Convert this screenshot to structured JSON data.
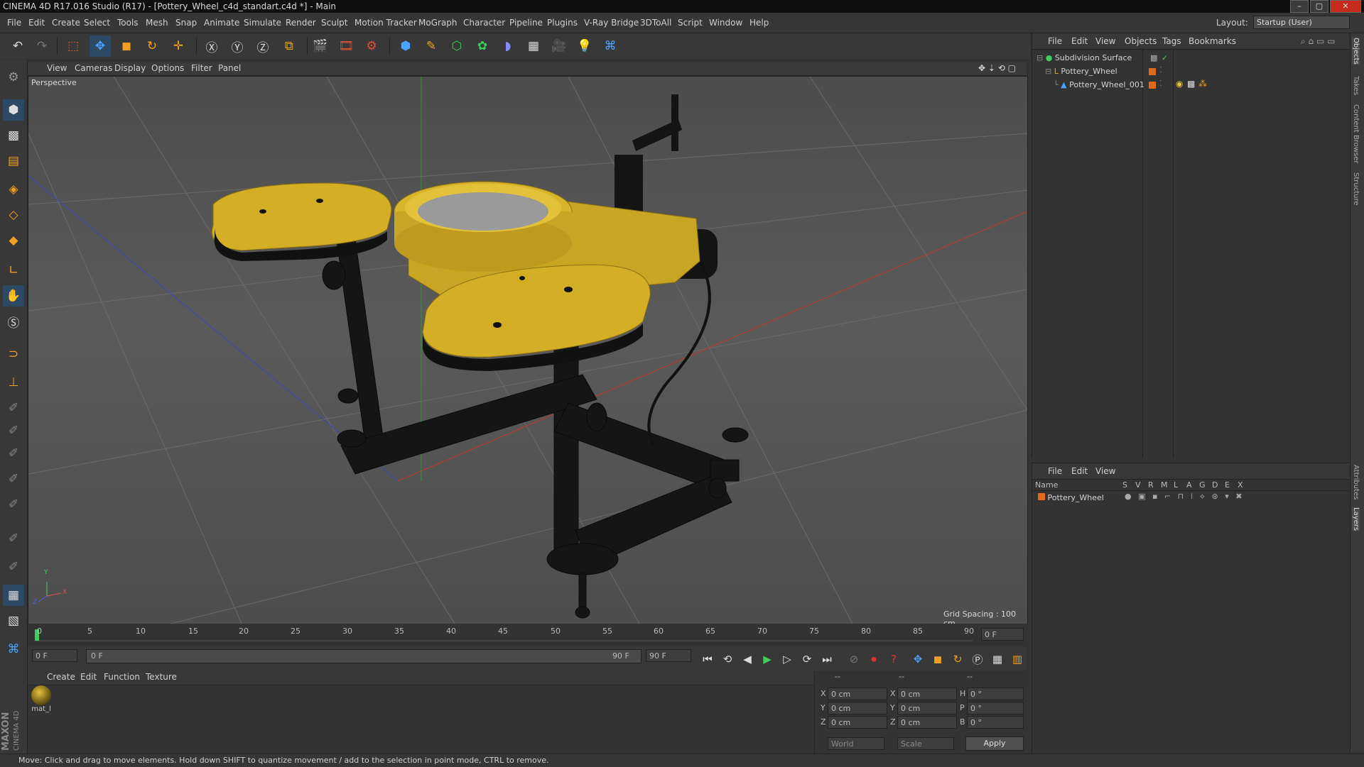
{
  "window": {
    "title": "CINEMA 4D R17.016 Studio (R17) - [Pottery_Wheel_c4d_standart.c4d *] - Main",
    "buttons": [
      "–",
      "▢",
      "✕"
    ]
  },
  "menubar": {
    "items": [
      "File",
      "Edit",
      "Create",
      "Select",
      "Tools",
      "Mesh",
      "Snap",
      "Animate",
      "Simulate",
      "Render",
      "Sculpt",
      "Motion Tracker",
      "MoGraph",
      "Character",
      "Pipeline",
      "Plugins",
      "V-Ray Bridge",
      "3DToAll",
      "Script",
      "Window",
      "Help"
    ],
    "layout_label": "Layout:",
    "layout_value": "Startup (User)"
  },
  "viewport": {
    "menu": [
      "View",
      "Cameras",
      "Display",
      "Options",
      "Filter",
      "Panel"
    ],
    "camera_label": "Perspective",
    "grid_spacing": "Grid Spacing : 100 cm",
    "axis_y": "Y",
    "axis_x": "X",
    "axis_z": "Z"
  },
  "timeline": {
    "ticks": [
      "0",
      "5",
      "10",
      "15",
      "20",
      "25",
      "30",
      "35",
      "40",
      "45",
      "50",
      "55",
      "60",
      "65",
      "70",
      "75",
      "80",
      "85",
      "90"
    ],
    "current_frame": "0 F",
    "start_field": "0 F",
    "range_start": "0 F",
    "range_end": "90 F",
    "end_field": "90 F"
  },
  "material_panel": {
    "menu": [
      "Create",
      "Edit",
      "Function",
      "Texture"
    ],
    "materials": [
      {
        "name": "mat_l"
      }
    ]
  },
  "coordinates": {
    "headers": [
      "--",
      "--",
      "--"
    ],
    "rows": [
      {
        "axis": "X",
        "pos": "0 cm",
        "axis2": "X",
        "size": "0 cm",
        "rot_axis": "H",
        "rot": "0 °"
      },
      {
        "axis": "Y",
        "pos": "0 cm",
        "axis2": "Y",
        "size": "0 cm",
        "rot_axis": "P",
        "rot": "0 °"
      },
      {
        "axis": "Z",
        "pos": "0 cm",
        "axis2": "Z",
        "size": "0 cm",
        "rot_axis": "B",
        "rot": "0 °"
      }
    ],
    "mode_world": "World",
    "mode_scale": "Scale",
    "apply": "Apply"
  },
  "object_manager": {
    "menu": [
      "File",
      "Edit",
      "View",
      "Objects",
      "Tags",
      "Bookmarks"
    ],
    "objects": [
      {
        "name": "Subdivision Surface"
      },
      {
        "name": "Pottery_Wheel"
      },
      {
        "name": "Pottery_Wheel_001"
      }
    ]
  },
  "layer_manager": {
    "menu": [
      "File",
      "Edit",
      "View"
    ],
    "columns": [
      "Name",
      "S",
      "V",
      "R",
      "M",
      "L",
      "A",
      "G",
      "D",
      "E",
      "X"
    ],
    "layers": [
      {
        "name": "Pottery_Wheel",
        "color": "#e06a1c"
      }
    ]
  },
  "right_tabs": [
    "Objects",
    "Takes",
    "Content Browser",
    "Structure",
    "Attributes",
    "Layers"
  ],
  "status": "Move: Click and drag to move elements. Hold down SHIFT to quantize movement / add to the selection in point mode, CTRL to remove.",
  "brand": {
    "maxon": "MAXON",
    "cinema": "CINEMA 4D"
  },
  "colors": {
    "accent_blue": "#4a90d9",
    "object_orange": "#e06a1c",
    "model_yellow": "#d8b42a",
    "grid_red": "#c0392b",
    "grid_green": "#2e9a3a",
    "grid_blue": "#3a48b8"
  }
}
